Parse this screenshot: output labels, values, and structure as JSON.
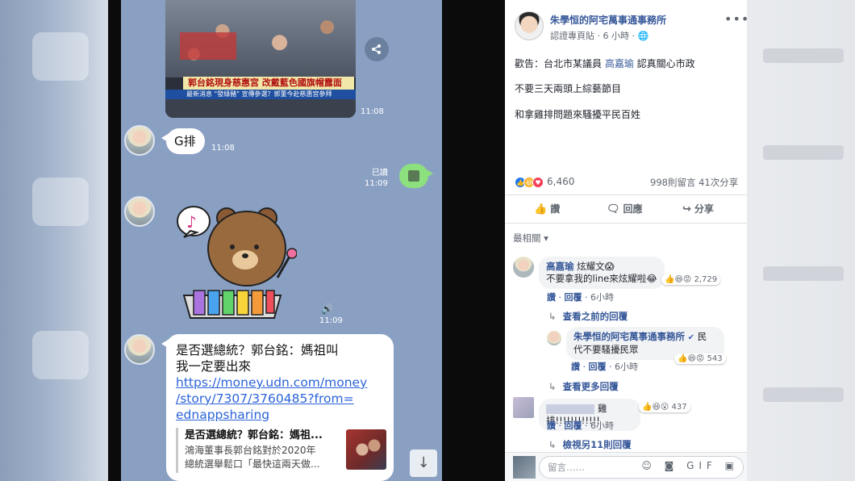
{
  "line_chat": {
    "video": {
      "headline": "郭台銘現身慈惠宮 改戴藍色國旗帽露面",
      "ticker": "最新消息 \"發綠豬\" 宣傳參選？郭董今赴慈惠宮參拜",
      "time": "11:08"
    },
    "msg_g": {
      "text": "G排",
      "time": "11:08"
    },
    "msg_sent": {
      "read": "已讀",
      "time": "11:09"
    },
    "sticker": {
      "time": "11:09",
      "note": "♪",
      "sound": "🔊"
    },
    "link_msg": {
      "text_line1": "是否選總統？郭台銘：媽祖叫",
      "text_line2": "我一定要出來",
      "url_line1": "https://money.udn.com/money",
      "url_line2": "/story/7307/3760485?from=",
      "url_line3": "ednappsharing",
      "preview_title": "是否選總統？郭台銘：媽祖...",
      "preview_desc1": "鴻海董事長郭台銘對於2020年",
      "preview_desc2": "總統選舉鬆口「最快這兩天做..."
    },
    "scroll_down": "↓",
    "share_icon": "⟨"
  },
  "fb_post": {
    "page_name": "朱學恒的阿宅萬事通事務所",
    "meta": "認證專頁貼 · 6 小時 · 🌐",
    "more": "•••",
    "line1_prefix": "歡告：台北市某議員 ",
    "line1_mention": "高嘉瑜",
    "line1_suffix": " 認真關心市政",
    "line2": "不要三天兩頭上綜藝節目",
    "line3": "和拿雞排問題來騷擾平民百姓",
    "reaction_count": "6,460",
    "comments_shares": "998則留言 41次分享",
    "actions": {
      "like": "讚",
      "comment": "回應",
      "share": "分享"
    },
    "sort": "最相關 ▾",
    "comments": [
      {
        "name": "高嘉瑜",
        "text_inline": " 炫耀文😱",
        "text2": "不要拿我的line來炫耀啦😂",
        "count": "2,729",
        "like": "讚",
        "reply": "回覆",
        "time": "6小時"
      },
      {
        "view_prev": "查看之前的回覆"
      },
      {
        "name": "朱學恒的阿宅萬事通事務所",
        "verified": "✔",
        "text_inline": " 民",
        "text2": "代不要騷擾民眾",
        "count": "543",
        "like": "讚",
        "reply": "回覆",
        "time": "6小時"
      },
      {
        "view_more": "查看更多回覆"
      },
      {
        "text": "雞排!!!!!!!!!!!!",
        "count": "437",
        "like": "讚",
        "reply": "回覆",
        "time": "6小時"
      },
      {
        "view_other": "檢視另11則回覆"
      }
    ],
    "input_placeholder": "留言……",
    "input_tools": "☺ ◙ GIF ▣"
  },
  "colors": {
    "line_bg": "#8aa0c3",
    "fb_link": "#365899",
    "green": "#8de07e"
  }
}
